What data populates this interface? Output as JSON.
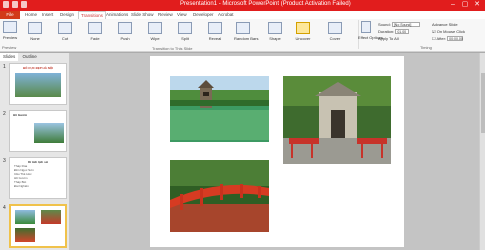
{
  "window": {
    "title": "Presentation1 - Microsoft PowerPoint (Product Activation Failed)"
  },
  "ribbon_tabs": [
    "File",
    "Home",
    "Insert",
    "Design",
    "Transitions",
    "Animations",
    "Slide Show",
    "Review",
    "View",
    "Developer",
    "Acrobat"
  ],
  "active_tab": "Transitions",
  "preview": {
    "label": "Preview",
    "group": "Preview"
  },
  "transitions": [
    {
      "label": "None",
      "selected": false
    },
    {
      "label": "Cut",
      "selected": false
    },
    {
      "label": "Fade",
      "selected": false
    },
    {
      "label": "Push",
      "selected": false
    },
    {
      "label": "Wipe",
      "selected": false
    },
    {
      "label": "Split",
      "selected": false
    },
    {
      "label": "Reveal",
      "selected": false
    },
    {
      "label": "Random Bars",
      "selected": false
    },
    {
      "label": "Shape",
      "selected": false
    },
    {
      "label": "Uncover",
      "selected": true
    },
    {
      "label": "Cover",
      "selected": false
    }
  ],
  "transition_group": "Transition to This Slide",
  "effect_options": "Effect Options",
  "timing": {
    "sound_label": "Sound:",
    "sound_value": "[No Sound]",
    "duration_label": "Duration:",
    "duration_value": "01.00",
    "apply_all": "Apply To All",
    "advance_label": "Advance Slide",
    "on_mouse": "On Mouse Click",
    "after_label": "After:",
    "after_value": "00:00.00",
    "group": "Timing"
  },
  "panel_tabs": {
    "slides": "Slides",
    "outline": "Outline"
  },
  "thumbs": [
    {
      "num": "1",
      "title": "BỐ CỤC ĐẸP HÀ NỘI"
    },
    {
      "num": "2",
      "title": "Hồ Gươm"
    },
    {
      "num": "3",
      "title": "Di tích lịch sử",
      "items": [
        "Tháp Rùa",
        "Đền Ngọc Sơn",
        "Cầu Thê Húc",
        "Hồ Gươm",
        "Tháp Bút",
        "Đài Nghiên"
      ]
    },
    {
      "num": "4"
    }
  ]
}
